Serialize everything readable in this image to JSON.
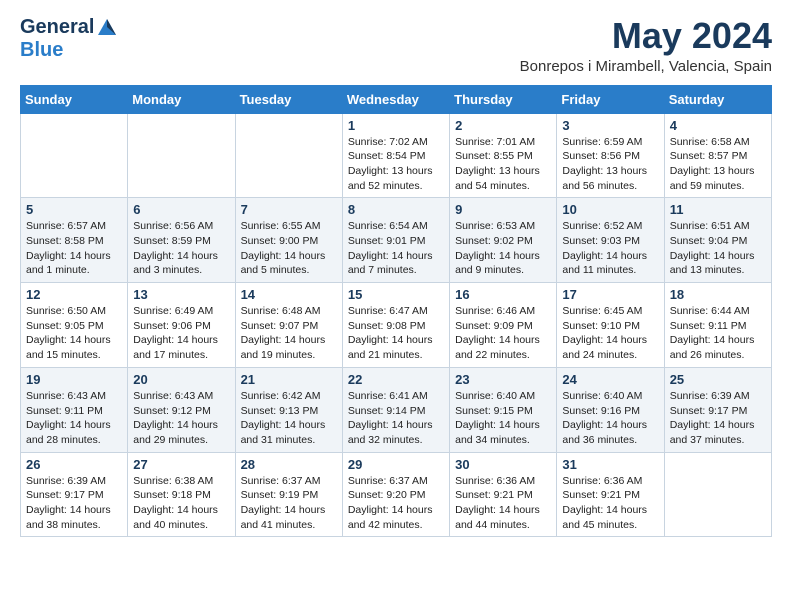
{
  "logo": {
    "general": "General",
    "blue": "Blue"
  },
  "title": "May 2024",
  "location": "Bonrepos i Mirambell, Valencia, Spain",
  "headers": [
    "Sunday",
    "Monday",
    "Tuesday",
    "Wednesday",
    "Thursday",
    "Friday",
    "Saturday"
  ],
  "weeks": [
    [
      {
        "day": "",
        "info": ""
      },
      {
        "day": "",
        "info": ""
      },
      {
        "day": "",
        "info": ""
      },
      {
        "day": "1",
        "info": "Sunrise: 7:02 AM\nSunset: 8:54 PM\nDaylight: 13 hours\nand 52 minutes."
      },
      {
        "day": "2",
        "info": "Sunrise: 7:01 AM\nSunset: 8:55 PM\nDaylight: 13 hours\nand 54 minutes."
      },
      {
        "day": "3",
        "info": "Sunrise: 6:59 AM\nSunset: 8:56 PM\nDaylight: 13 hours\nand 56 minutes."
      },
      {
        "day": "4",
        "info": "Sunrise: 6:58 AM\nSunset: 8:57 PM\nDaylight: 13 hours\nand 59 minutes."
      }
    ],
    [
      {
        "day": "5",
        "info": "Sunrise: 6:57 AM\nSunset: 8:58 PM\nDaylight: 14 hours\nand 1 minute."
      },
      {
        "day": "6",
        "info": "Sunrise: 6:56 AM\nSunset: 8:59 PM\nDaylight: 14 hours\nand 3 minutes."
      },
      {
        "day": "7",
        "info": "Sunrise: 6:55 AM\nSunset: 9:00 PM\nDaylight: 14 hours\nand 5 minutes."
      },
      {
        "day": "8",
        "info": "Sunrise: 6:54 AM\nSunset: 9:01 PM\nDaylight: 14 hours\nand 7 minutes."
      },
      {
        "day": "9",
        "info": "Sunrise: 6:53 AM\nSunset: 9:02 PM\nDaylight: 14 hours\nand 9 minutes."
      },
      {
        "day": "10",
        "info": "Sunrise: 6:52 AM\nSunset: 9:03 PM\nDaylight: 14 hours\nand 11 minutes."
      },
      {
        "day": "11",
        "info": "Sunrise: 6:51 AM\nSunset: 9:04 PM\nDaylight: 14 hours\nand 13 minutes."
      }
    ],
    [
      {
        "day": "12",
        "info": "Sunrise: 6:50 AM\nSunset: 9:05 PM\nDaylight: 14 hours\nand 15 minutes."
      },
      {
        "day": "13",
        "info": "Sunrise: 6:49 AM\nSunset: 9:06 PM\nDaylight: 14 hours\nand 17 minutes."
      },
      {
        "day": "14",
        "info": "Sunrise: 6:48 AM\nSunset: 9:07 PM\nDaylight: 14 hours\nand 19 minutes."
      },
      {
        "day": "15",
        "info": "Sunrise: 6:47 AM\nSunset: 9:08 PM\nDaylight: 14 hours\nand 21 minutes."
      },
      {
        "day": "16",
        "info": "Sunrise: 6:46 AM\nSunset: 9:09 PM\nDaylight: 14 hours\nand 22 minutes."
      },
      {
        "day": "17",
        "info": "Sunrise: 6:45 AM\nSunset: 9:10 PM\nDaylight: 14 hours\nand 24 minutes."
      },
      {
        "day": "18",
        "info": "Sunrise: 6:44 AM\nSunset: 9:11 PM\nDaylight: 14 hours\nand 26 minutes."
      }
    ],
    [
      {
        "day": "19",
        "info": "Sunrise: 6:43 AM\nSunset: 9:11 PM\nDaylight: 14 hours\nand 28 minutes."
      },
      {
        "day": "20",
        "info": "Sunrise: 6:43 AM\nSunset: 9:12 PM\nDaylight: 14 hours\nand 29 minutes."
      },
      {
        "day": "21",
        "info": "Sunrise: 6:42 AM\nSunset: 9:13 PM\nDaylight: 14 hours\nand 31 minutes."
      },
      {
        "day": "22",
        "info": "Sunrise: 6:41 AM\nSunset: 9:14 PM\nDaylight: 14 hours\nand 32 minutes."
      },
      {
        "day": "23",
        "info": "Sunrise: 6:40 AM\nSunset: 9:15 PM\nDaylight: 14 hours\nand 34 minutes."
      },
      {
        "day": "24",
        "info": "Sunrise: 6:40 AM\nSunset: 9:16 PM\nDaylight: 14 hours\nand 36 minutes."
      },
      {
        "day": "25",
        "info": "Sunrise: 6:39 AM\nSunset: 9:17 PM\nDaylight: 14 hours\nand 37 minutes."
      }
    ],
    [
      {
        "day": "26",
        "info": "Sunrise: 6:39 AM\nSunset: 9:17 PM\nDaylight: 14 hours\nand 38 minutes."
      },
      {
        "day": "27",
        "info": "Sunrise: 6:38 AM\nSunset: 9:18 PM\nDaylight: 14 hours\nand 40 minutes."
      },
      {
        "day": "28",
        "info": "Sunrise: 6:37 AM\nSunset: 9:19 PM\nDaylight: 14 hours\nand 41 minutes."
      },
      {
        "day": "29",
        "info": "Sunrise: 6:37 AM\nSunset: 9:20 PM\nDaylight: 14 hours\nand 42 minutes."
      },
      {
        "day": "30",
        "info": "Sunrise: 6:36 AM\nSunset: 9:21 PM\nDaylight: 14 hours\nand 44 minutes."
      },
      {
        "day": "31",
        "info": "Sunrise: 6:36 AM\nSunset: 9:21 PM\nDaylight: 14 hours\nand 45 minutes."
      },
      {
        "day": "",
        "info": ""
      }
    ]
  ]
}
